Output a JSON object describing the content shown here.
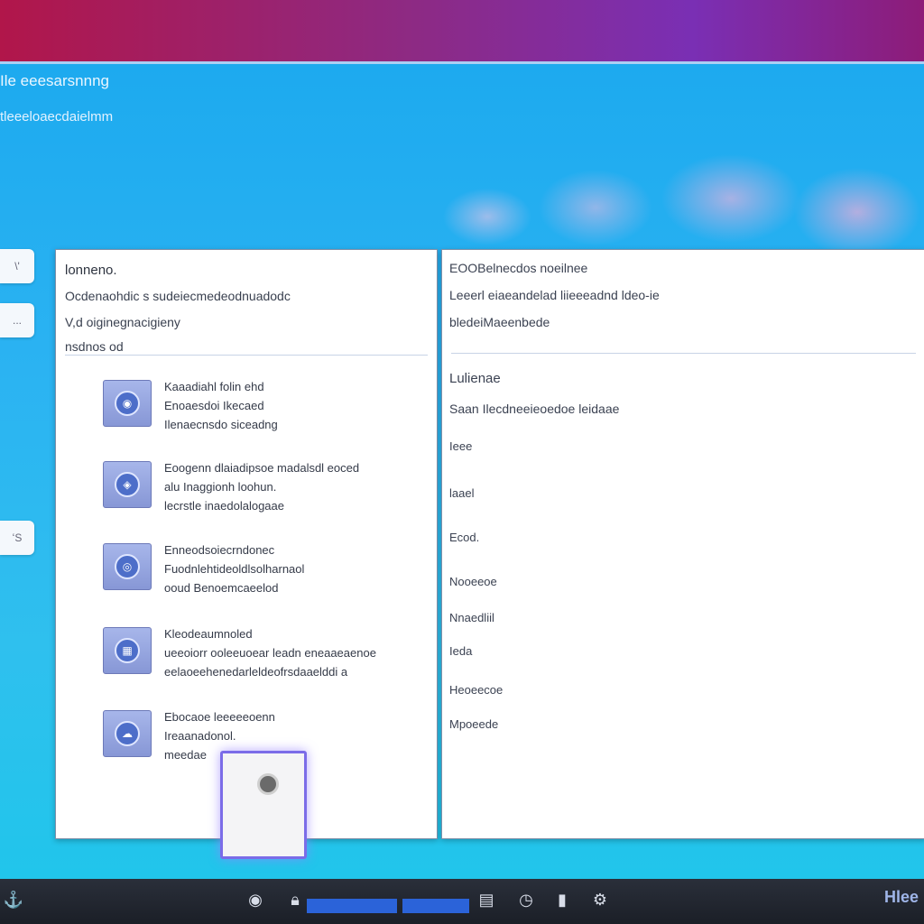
{
  "header": {
    "title": "Ile eeesarsnnng",
    "subtitle": "tleeeloaecdaielmm"
  },
  "left_panel": {
    "heading": "lonneno.",
    "line2": "Ocdenaohdic s sudeiecmedeodnuadodc",
    "line3": "V,d oiginegnacigieny",
    "line4": "nsdnos od",
    "items": [
      {
        "icon": "disk-icon",
        "glyph": "◉",
        "lines": [
          "Kaaadiahl folin ehd",
          "Enoaesdoi Ikecaed",
          "Ilenaecnsdo siceadng"
        ]
      },
      {
        "icon": "shield-icon",
        "glyph": "◈",
        "lines": [
          "Eoogenn  dlaiadipsoe madalsdl eoced",
          "alu Inaggionh loohun.",
          "lecrstle inaedolalogaae"
        ]
      },
      {
        "icon": "globe-icon",
        "glyph": "◎",
        "lines": [
          "Enneodsoiecrndonec",
          "Fuodnlehtideoldlsolharnaol",
          "ooud Benoemcaeelod"
        ]
      },
      {
        "icon": "grid-icon",
        "glyph": "▦",
        "lines": [
          "Kleodeaumnoled",
          "ueeoiorr ooleeuoear leadn eneaaeaenoe",
          "eelaoeehenedarleldeofrsdaaelddi a"
        ]
      },
      {
        "icon": "cloud-icon",
        "glyph": "☁",
        "lines": [
          "Ebocaoe  leeeeeoenn",
          "Ireaanadonol.",
          "meedae"
        ]
      }
    ]
  },
  "right_panel": {
    "line1": "EOOBelnecdos noeilnee",
    "line2": "Leeerl  eiaeandelad  liieeeadnd ldeo-ie",
    "line3": "bledeiMaeenbede",
    "section_heading": "Lulienae",
    "section_line": "Saan Ilecdneeieoedoe leidaae",
    "items": [
      "Ieee",
      "laael",
      "Ecod.",
      "Nooeeoe",
      "Nnaedliil",
      "Ieda",
      "Heoeecoe",
      "Mpoeede"
    ]
  },
  "side_tabs": [
    "\\'",
    "...",
    "ʻS"
  ],
  "taskbar": {
    "clock": "Hlee"
  },
  "colors": {
    "accent": "#7b6ce8",
    "top_band": "#8d2a84",
    "desktop": "#1aa8ee",
    "taskbar": "#1b1f27"
  }
}
